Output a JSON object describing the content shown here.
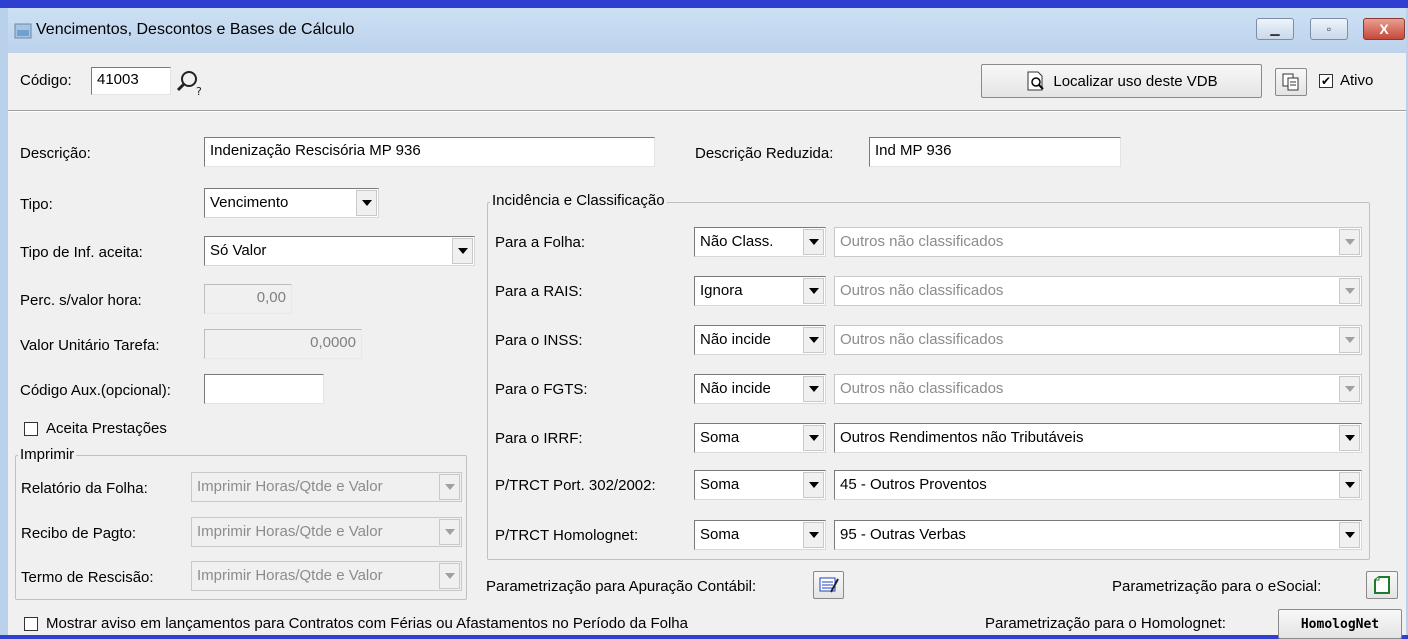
{
  "window": {
    "title": "Vencimentos, Descontos e Bases de Cálculo",
    "minimize": "▁",
    "maximize": "▫",
    "close": "X"
  },
  "toolbar": {
    "codigo_label": "Código:",
    "codigo_value": "41003",
    "localizar_label": "Localizar uso deste VDB",
    "ativo_label": "Ativo",
    "ativo_checked": "✔"
  },
  "form": {
    "descricao_label": "Descrição:",
    "descricao_value": "Indenização Rescisória MP 936",
    "descricao_reduzida_label": "Descrição Reduzida:",
    "descricao_reduzida_value": "Ind MP 936",
    "tipo_label": "Tipo:",
    "tipo_value": "Vencimento",
    "tipo_inf_label": "Tipo de Inf. aceita:",
    "tipo_inf_value": "Só Valor",
    "perc_label": "Perc. s/valor hora:",
    "perc_value": "0,00",
    "valor_unit_label": "Valor Unitário Tarefa:",
    "valor_unit_value": "0,0000",
    "codigo_aux_label": "Código Aux.(opcional):",
    "codigo_aux_value": "",
    "aceita_prestacoes_label": "Aceita Prestações"
  },
  "imprimir": {
    "legend": "Imprimir",
    "rows": [
      {
        "label": "Relatório da Folha:",
        "value": "Imprimir Horas/Qtde e Valor"
      },
      {
        "label": "Recibo de Pagto:",
        "value": "Imprimir Horas/Qtde e Valor"
      },
      {
        "label": "Termo de Rescisão:",
        "value": "Imprimir Horas/Qtde e Valor"
      }
    ]
  },
  "incidencia": {
    "legend": "Incidência e Classificação",
    "rows": [
      {
        "label": "Para a Folha:",
        "value": "Não Class.",
        "classificacao": "Outros não classificados"
      },
      {
        "label": "Para a RAIS:",
        "value": "Ignora",
        "classificacao": "Outros não classificados"
      },
      {
        "label": "Para o INSS:",
        "value": "Não incide",
        "classificacao": "Outros não classificados"
      },
      {
        "label": "Para o FGTS:",
        "value": "Não incide",
        "classificacao": "Outros não classificados"
      },
      {
        "label": "Para o IRRF:",
        "value": "Soma",
        "classificacao": "Outros Rendimentos não Tributáveis"
      },
      {
        "label": "P/TRCT Port. 302/2002:",
        "value": "Soma",
        "classificacao": "45 - Outros Proventos"
      },
      {
        "label": "P/TRCT Homolognet:",
        "value": "Soma",
        "classificacao": "95 - Outras Verbas"
      }
    ]
  },
  "footer": {
    "apuracao_label": "Parametrização para Apuração Contábil:",
    "esocial_label": "Parametrização para o eSocial:",
    "homolognet_label": "Parametrização para o Homolognet:",
    "homolognet_button": "HomologNet",
    "mostrar_aviso_label": "Mostrar aviso em lançamentos para Contratos com Férias ou Afastamentos no Período da Folha"
  }
}
